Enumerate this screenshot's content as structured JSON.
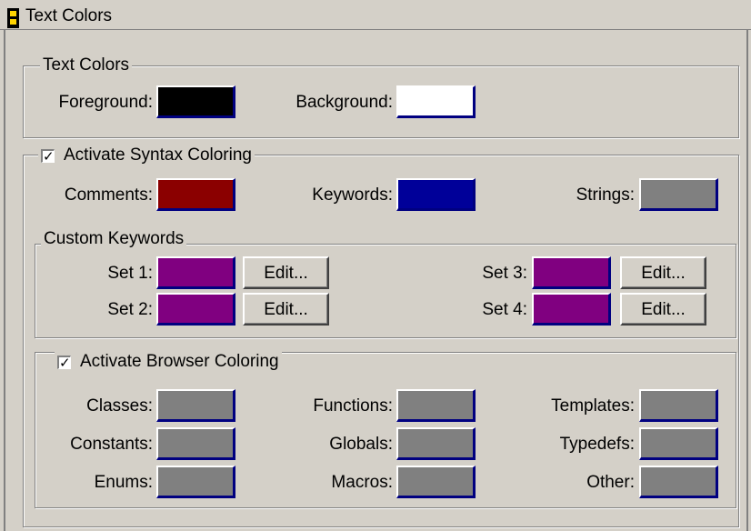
{
  "window": {
    "title": "Text Colors"
  },
  "text_colors": {
    "legend": "Text Colors",
    "foreground": {
      "label": "Foreground:",
      "color": "#000000"
    },
    "background": {
      "label": "Background:",
      "color": "#ffffff"
    }
  },
  "syntax": {
    "checkbox_label": "Activate Syntax Coloring",
    "checked": true,
    "check_mark": "✓",
    "comments": {
      "label": "Comments:",
      "color": "#8b0000"
    },
    "keywords": {
      "label": "Keywords:",
      "color": "#000099"
    },
    "strings": {
      "label": "Strings:",
      "color": "#808080"
    }
  },
  "custom_keywords": {
    "legend": "Custom Keywords",
    "edit_label": "Edit...",
    "sets": [
      {
        "label": "Set 1:",
        "color": "#800080"
      },
      {
        "label": "Set 2:",
        "color": "#800080"
      },
      {
        "label": "Set 3:",
        "color": "#800080"
      },
      {
        "label": "Set 4:",
        "color": "#800080"
      }
    ]
  },
  "browser": {
    "checkbox_label": "Activate Browser Coloring",
    "checked": true,
    "check_mark": "✓",
    "items": [
      {
        "label": "Classes:",
        "color": "#808080"
      },
      {
        "label": "Functions:",
        "color": "#808080"
      },
      {
        "label": "Templates:",
        "color": "#808080"
      },
      {
        "label": "Constants:",
        "color": "#808080"
      },
      {
        "label": "Globals:",
        "color": "#808080"
      },
      {
        "label": "Typedefs:",
        "color": "#808080"
      },
      {
        "label": "Enums:",
        "color": "#808080"
      },
      {
        "label": "Macros:",
        "color": "#808080"
      },
      {
        "label": "Other:",
        "color": "#808080"
      }
    ]
  }
}
